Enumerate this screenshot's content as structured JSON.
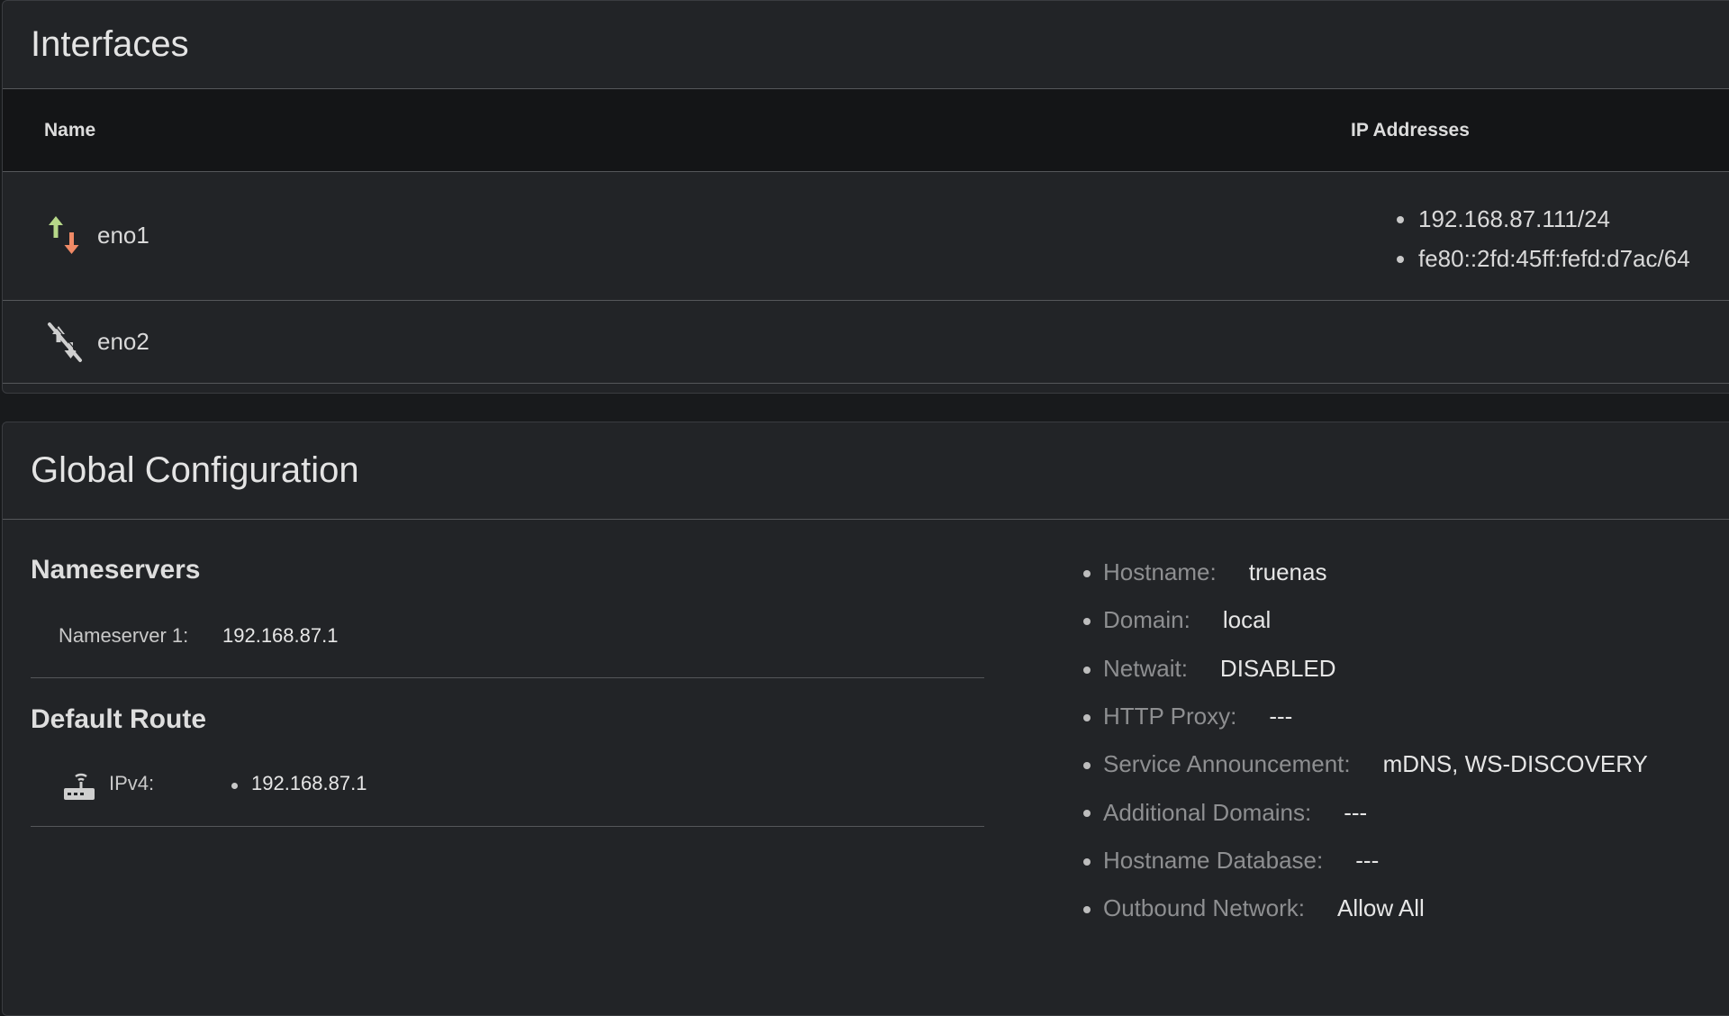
{
  "interfaces": {
    "title": "Interfaces",
    "columns": {
      "name": "Name",
      "ip": "IP Addresses"
    },
    "rows": [
      {
        "name": "eno1",
        "status_icon": "link-up-down-arrows-icon",
        "ips": [
          "192.168.87.111/24",
          "fe80::2fd:45ff:fefd:d7ac/64"
        ]
      },
      {
        "name": "eno2",
        "status_icon": "link-disconnected-icon",
        "ips": []
      }
    ]
  },
  "global": {
    "title": "Global Configuration",
    "nameservers": {
      "title": "Nameservers",
      "items": [
        {
          "label": "Nameserver 1:",
          "value": "192.168.87.1"
        }
      ]
    },
    "default_route": {
      "title": "Default Route",
      "icon": "router-icon",
      "label": "IPv4:",
      "values": [
        "192.168.87.1"
      ]
    },
    "settings": [
      {
        "label": "Hostname:",
        "value": "truenas"
      },
      {
        "label": "Domain:",
        "value": "local"
      },
      {
        "label": "Netwait:",
        "value": "DISABLED"
      },
      {
        "label": "HTTP Proxy:",
        "value": "---"
      },
      {
        "label": "Service Announcement:",
        "value": "mDNS, WS-DISCOVERY"
      },
      {
        "label": "Additional Domains:",
        "value": "---"
      },
      {
        "label": "Hostname Database:",
        "value": "---"
      },
      {
        "label": "Outbound Network:",
        "value": "Allow All"
      }
    ]
  },
  "colors": {
    "arrow_up": "#b7d889",
    "arrow_down": "#f08a66",
    "background": "#181a1c",
    "card": "#222427",
    "header_row": "#141517"
  }
}
